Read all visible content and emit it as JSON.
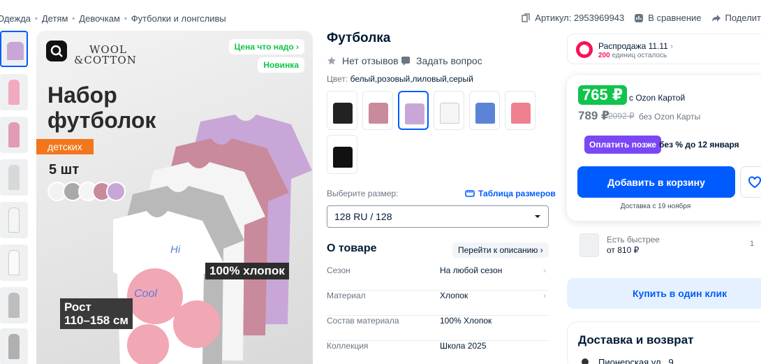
{
  "breadcrumbs": [
    "Одежда",
    "Детям",
    "Девочкам",
    "Футболки и лонгсливы"
  ],
  "meta": {
    "article": "Артикул: 2953969943",
    "compare": "В сравнение",
    "share": "Поделит"
  },
  "gallery": {
    "brand_line1": "WOOL",
    "brand_line2": "&COTTON",
    "tag_price": "Цена что надо",
    "tag_new": "Новинка",
    "headline_line1": "Набор",
    "headline_line2": "футболок",
    "orange_label": "детских",
    "count": "5 шт",
    "cotton": "100% хлопок",
    "height_line1": "Рост",
    "height_line2": "110–158 см",
    "hi_text": "Hi",
    "cool_text": "Cool",
    "shirt_colors": [
      "#c9a6d8",
      "#c98a9b",
      "#f5f5f5",
      "#b9b9b9",
      "#ffffff"
    ],
    "dot_colors": [
      "#f2f2f2",
      "#a9a9a9",
      "#f5f5f5",
      "#c98a9b",
      "#c9a6d8"
    ]
  },
  "product": {
    "title": "Футболка",
    "reviews": "Нет отзывов",
    "ask": "Задать вопрос",
    "color_label": "Цвет:",
    "color_value": "белый,розовый,лиловый,серый",
    "size_label": "Выберите размер:",
    "size_table": "Таблица размеров",
    "size_value": "128 RU / 128",
    "about_title": "О товаре",
    "goto_desc": "Перейти к описанию",
    "specs": [
      {
        "key": "Сезон",
        "value": "На любой сезон"
      },
      {
        "key": "Материал",
        "value": "Хлопок"
      },
      {
        "key": "Состав материала",
        "value": "100% Хлопок"
      },
      {
        "key": "Коллекция",
        "value": "Школа 2025"
      }
    ]
  },
  "sale": {
    "title": "Распродажа 11.11",
    "count": "200",
    "count_note": "единиц осталось"
  },
  "price": {
    "ozon_price": "765 ₽",
    "ozon_note": "с Ozon Картой",
    "regular": "789 ₽",
    "old": "2092 ₽",
    "regular_note": "без Ozon Карты",
    "pay_later": "Оплатить позже",
    "pay_note": "без % до 12 января",
    "cart": "Добавить в корзину",
    "delivery": "Доставка с 19 ноября"
  },
  "faster": {
    "line1": "Есть быстрее",
    "line2": "от 810 ₽",
    "qty": "1"
  },
  "one_click": "Купить в один клик",
  "delivery_block": {
    "title": "Доставка и возврат",
    "address": "Пионерская ул., 9"
  },
  "colors": {
    "accent": "#005bff",
    "green": "#10c44c",
    "sale": "#f91155",
    "purple": "#7b47f5",
    "orange": "#f2761b"
  }
}
